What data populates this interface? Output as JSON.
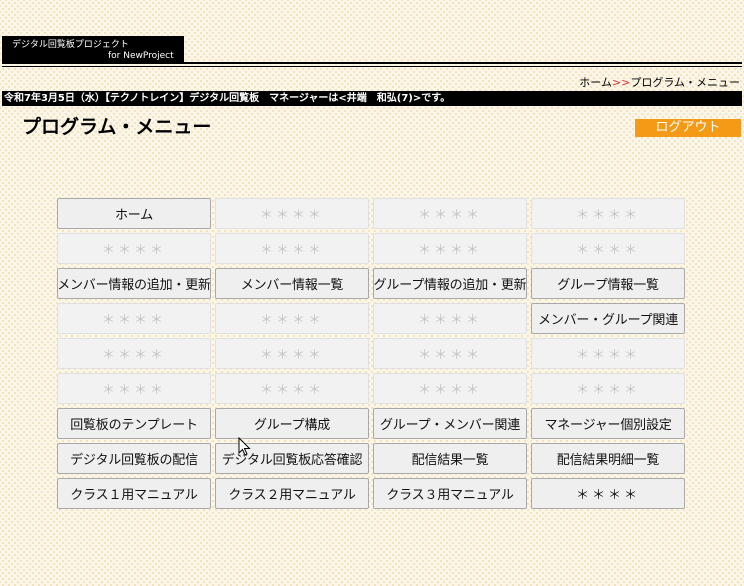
{
  "header": {
    "logo_line1": "デジタル回覧板プロジェクト",
    "logo_line2": "for NewProject"
  },
  "breadcrumb": {
    "home": "ホーム",
    "separator": ">>",
    "current": "プログラム・メニュー"
  },
  "infobar": {
    "text": "令和7年3月5日（水）【テクノトレイン】デジタル回覧板　マネージャーは<井端　和弘(7)>です。"
  },
  "page": {
    "title": "プログラム・メニュー",
    "logout_label": "ログアウト"
  },
  "menu": {
    "rows": [
      [
        {
          "label": "ホーム",
          "state": "active"
        },
        {
          "label": "＊＊＊＊",
          "state": "disabled"
        },
        {
          "label": "＊＊＊＊",
          "state": "disabled"
        },
        {
          "label": "＊＊＊＊",
          "state": "disabled"
        }
      ],
      [
        {
          "label": "＊＊＊＊",
          "state": "disabled"
        },
        {
          "label": "＊＊＊＊",
          "state": "disabled"
        },
        {
          "label": "＊＊＊＊",
          "state": "disabled"
        },
        {
          "label": "＊＊＊＊",
          "state": "disabled"
        }
      ],
      [
        {
          "label": "メンバー情報の追加・更新",
          "state": "active"
        },
        {
          "label": "メンバー情報一覧",
          "state": "active"
        },
        {
          "label": "グループ情報の追加・更新",
          "state": "active"
        },
        {
          "label": "グループ情報一覧",
          "state": "active"
        }
      ],
      [
        {
          "label": "＊＊＊＊",
          "state": "disabled"
        },
        {
          "label": "＊＊＊＊",
          "state": "disabled"
        },
        {
          "label": "＊＊＊＊",
          "state": "disabled"
        },
        {
          "label": "メンバー・グループ関連",
          "state": "active"
        }
      ],
      [
        {
          "label": "＊＊＊＊",
          "state": "disabled"
        },
        {
          "label": "＊＊＊＊",
          "state": "disabled"
        },
        {
          "label": "＊＊＊＊",
          "state": "disabled"
        },
        {
          "label": "＊＊＊＊",
          "state": "disabled"
        }
      ],
      [
        {
          "label": "＊＊＊＊",
          "state": "disabled"
        },
        {
          "label": "＊＊＊＊",
          "state": "disabled"
        },
        {
          "label": "＊＊＊＊",
          "state": "disabled"
        },
        {
          "label": "＊＊＊＊",
          "state": "disabled"
        }
      ],
      [
        {
          "label": "回覧板のテンプレート",
          "state": "active"
        },
        {
          "label": "グループ構成",
          "state": "active"
        },
        {
          "label": "グループ・メンバー関連",
          "state": "active"
        },
        {
          "label": "マネージャー個別設定",
          "state": "active"
        }
      ],
      [
        {
          "label": "デジタル回覧板の配信",
          "state": "active"
        },
        {
          "label": "デジタル回覧板応答確認",
          "state": "active"
        },
        {
          "label": "配信結果一覧",
          "state": "active"
        },
        {
          "label": "配信結果明細一覧",
          "state": "active"
        }
      ],
      [
        {
          "label": "クラス１用マニュアル",
          "state": "active"
        },
        {
          "label": "クラス２用マニュアル",
          "state": "active"
        },
        {
          "label": "クラス３用マニュアル",
          "state": "active"
        },
        {
          "label": "＊＊＊＊",
          "state": "placeholder"
        }
      ]
    ]
  },
  "colors": {
    "logout_bg": "#f59a16",
    "breadcrumb_separator": "#e03030",
    "header_bar": "#000000"
  },
  "icons": {
    "cursor": "mouse-pointer-icon"
  }
}
